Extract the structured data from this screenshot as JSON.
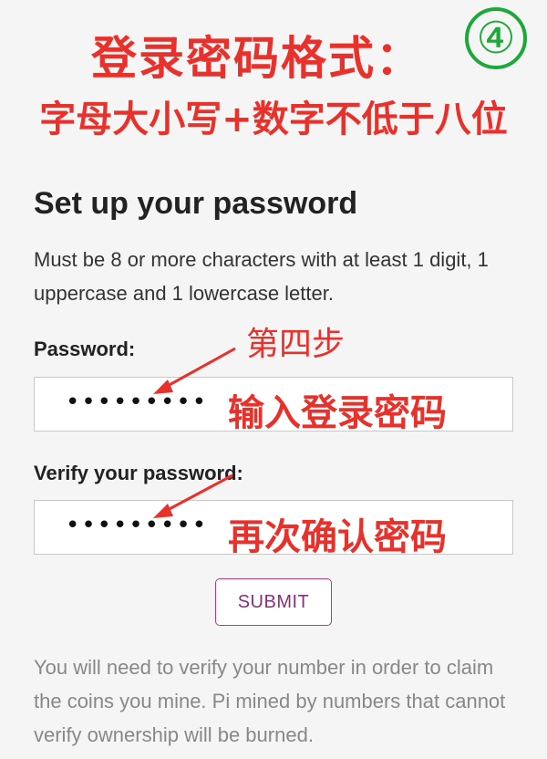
{
  "annotations": {
    "heading": "登录密码格式：",
    "subheading": "字母大小写+数字不低于八位",
    "step_badge": "④",
    "step_label": "第四步",
    "enter_password": "输入登录密码",
    "confirm_password": "再次确认密码",
    "color": "#e8312b",
    "badge_color": "#1fa83a"
  },
  "form": {
    "title": "Set up your password",
    "description": "Must be 8 or more characters with at least 1 digit, 1 uppercase and 1 lowercase letter.",
    "password_label": "Password:",
    "password_value": "•••••••••",
    "verify_label": "Verify your password:",
    "verify_value": "•••••••••",
    "submit_label": "SUBMIT",
    "accent_color": "#8b2e7e"
  },
  "footer": {
    "note": "You will need to verify your number in order to claim the coins you mine. Pi mined by numbers that cannot verify ownership will be burned."
  }
}
